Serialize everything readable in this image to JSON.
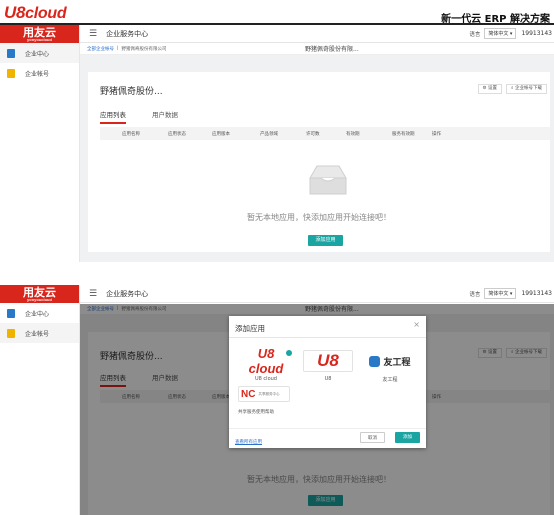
{
  "doc": {
    "logo_u8": "U8",
    "logo_cloud": "cloud",
    "title": "新一代云 ERP 解决方案"
  },
  "app": {
    "brand": "用友云",
    "brand_sub": "yonyoucloud",
    "sidebar": [
      {
        "label": "企业中心"
      },
      {
        "label": "企业帐号"
      }
    ],
    "header_title": "企业服务中心",
    "lang_label": "语言",
    "lang_value": "简体中文 ▾",
    "user_id": "19913143",
    "crumb_link": "全部企业帐号",
    "crumb_sep": "|",
    "crumb_company": "野猪佩奇股份有限公司",
    "crumb_center": "野猪佩奇股份有限...",
    "company_name": "野猪佩奇股份...",
    "btn_settings": "设置",
    "btn_download": "企业帐号下载",
    "tabs": [
      "应用列表",
      "用户数据"
    ],
    "columns": [
      "应用名称",
      "应用状态",
      "应用版本",
      "产品领域",
      "许可数",
      "有效期",
      "服务有效期",
      "操作"
    ],
    "empty_text": "暂无本地应用，快添加应用开始连接吧！",
    "add_btn": "添加应用"
  },
  "modal": {
    "title": "添加应用",
    "close": "×",
    "apps": [
      {
        "label": "U8 cloud"
      },
      {
        "label": "U8"
      },
      {
        "label": "友工程"
      }
    ],
    "nc_caption": "共享服务使用帮助",
    "nc_sub": "共享服务中心",
    "show_all": "查看所有应用",
    "cancel": "取消",
    "confirm": "添加"
  },
  "colors": {
    "brand_red": "#d9261c",
    "teal": "#1aa5a3",
    "link": "#2a6fc9"
  }
}
